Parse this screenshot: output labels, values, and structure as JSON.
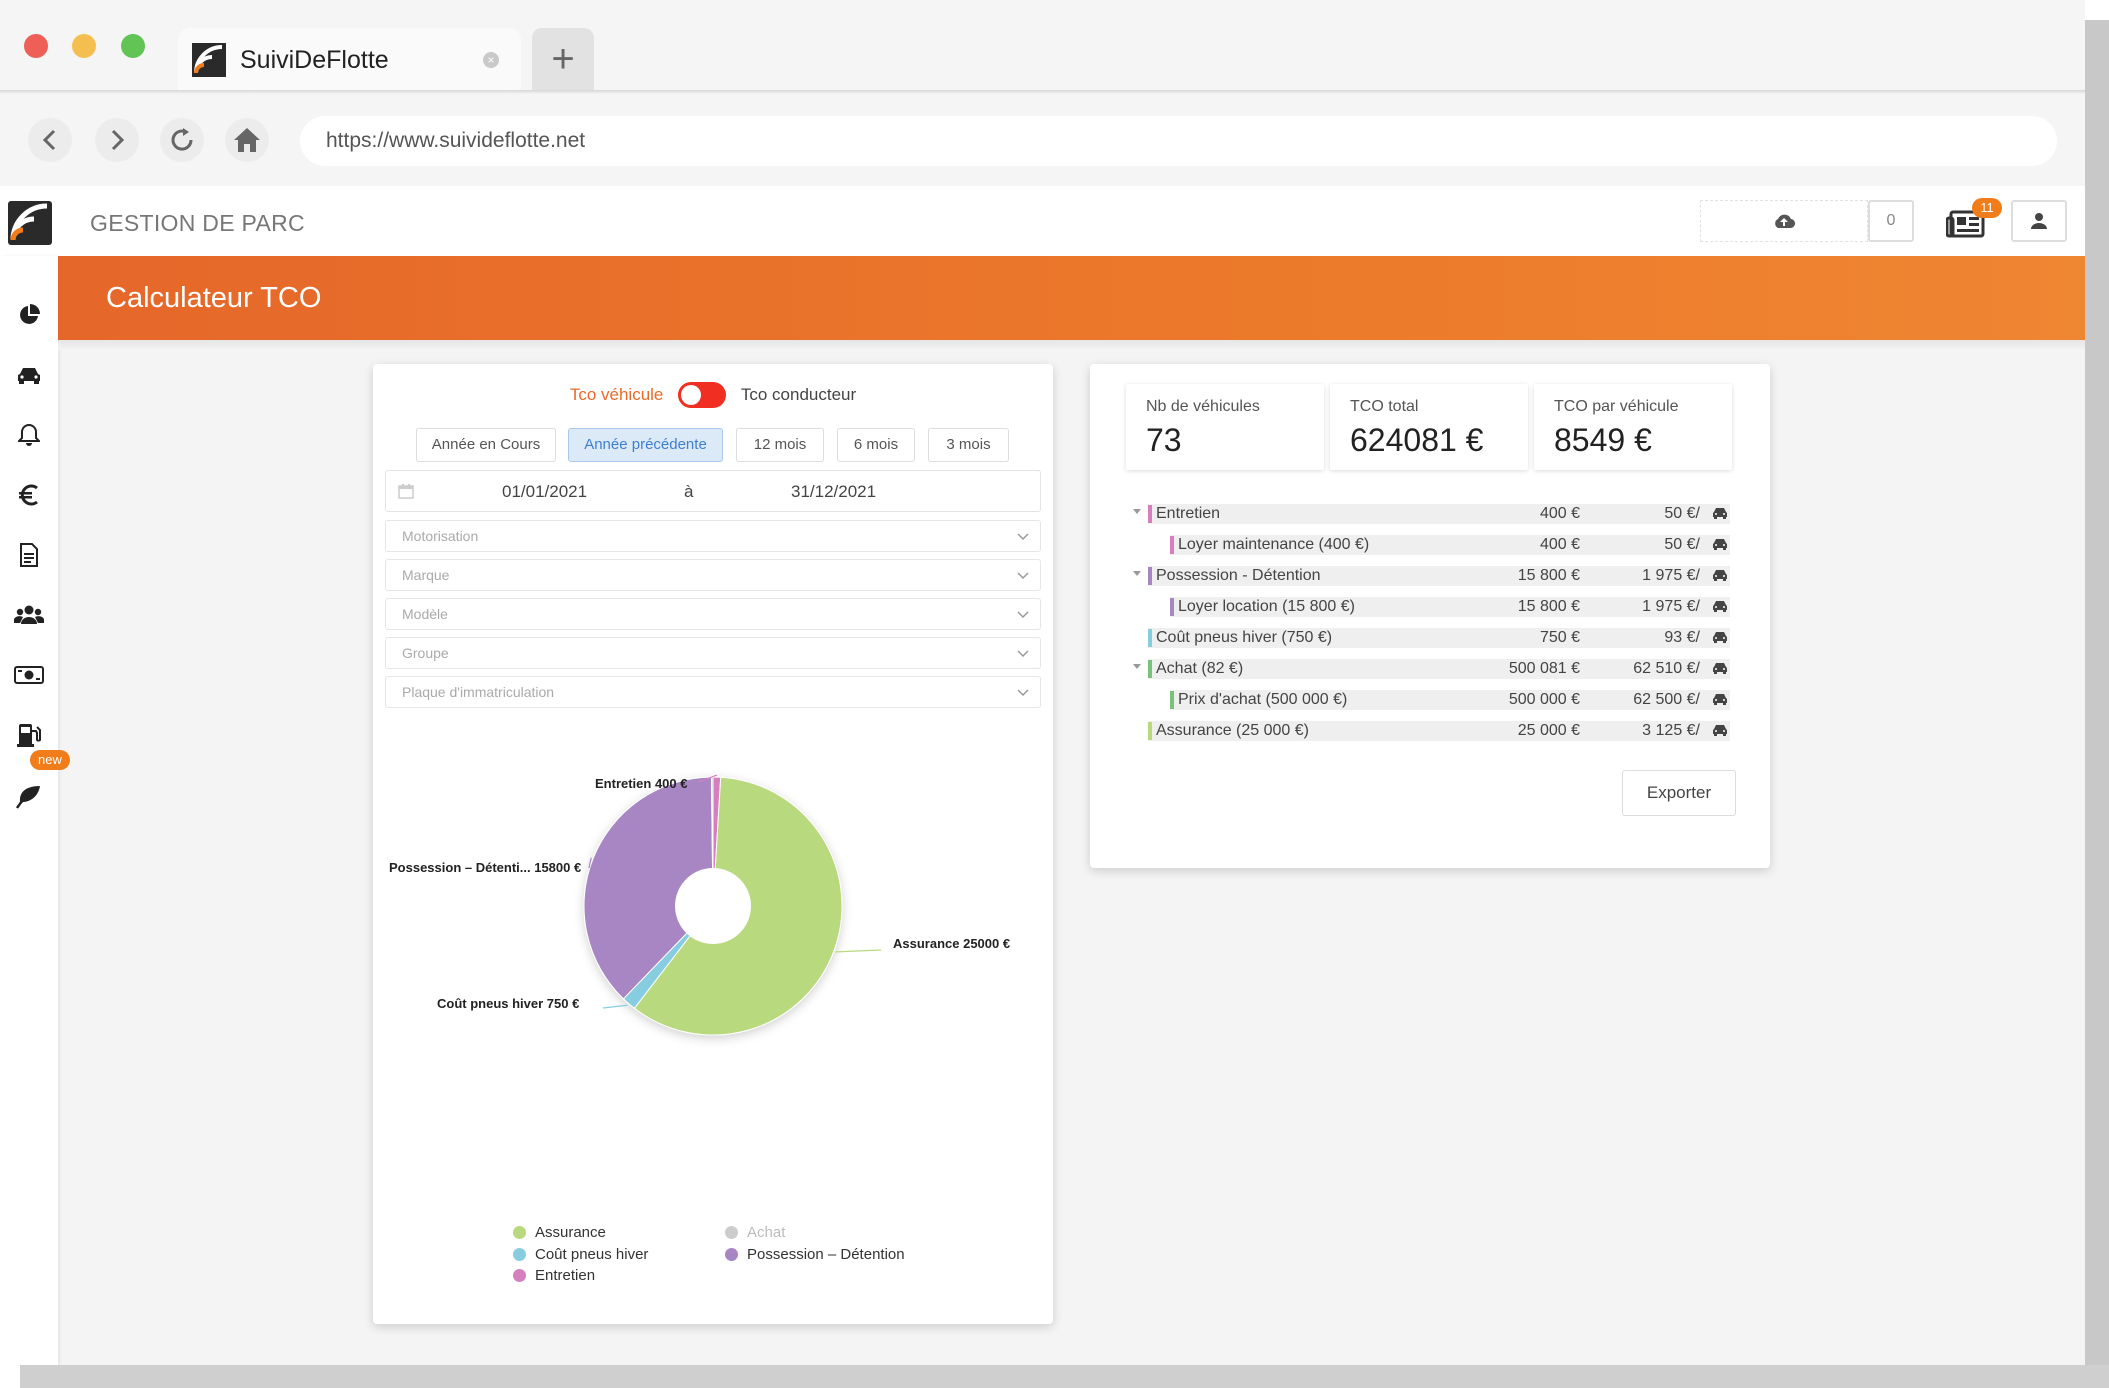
{
  "browser": {
    "tab_title": "SuiviDeFlotte",
    "tab_close": "×",
    "new_tab": "+",
    "url": "https://www.suivideflotte.net"
  },
  "header": {
    "app_title": "GESTION DE PARC",
    "upload_count": "0",
    "news_badge": "11"
  },
  "sidebar": {
    "icons": [
      "pie-chart-icon",
      "car-icon",
      "bell-icon",
      "euro-icon",
      "document-icon",
      "users-icon",
      "money-icon",
      "fuel-pump-icon",
      "leaf-icon"
    ],
    "new_badge": "new"
  },
  "page": {
    "title": "Calculateur TCO"
  },
  "filters": {
    "toggle_left": "Tco véhicule",
    "toggle_right": "Tco conducteur",
    "periods": [
      "Année en Cours",
      "Année précédente",
      "12 mois",
      "6 mois",
      "3 mois"
    ],
    "selected_period": "Année précédente",
    "date_from": "01/01/2021",
    "date_sep": "à",
    "date_to": "31/12/2021",
    "selects": [
      "Motorisation",
      "Marque",
      "Modèle",
      "Groupe",
      "Plaque d'immatriculation"
    ]
  },
  "chart_data": {
    "type": "pie",
    "donut": true,
    "slices": [
      {
        "name": "Entretien",
        "value": 400,
        "color": "#d67fbf",
        "label": "Entretien 400 €"
      },
      {
        "name": "Assurance",
        "value": 25000,
        "color": "#b9d97f",
        "label": "Assurance 25000 €"
      },
      {
        "name": "Coût pneus hiver",
        "value": 750,
        "color": "#86cde0",
        "label": "Coût pneus hiver 750 €"
      },
      {
        "name": "Possession – Détention",
        "value": 15800,
        "color": "#a886c4",
        "label": "Possession – Détenti... 15800 €"
      },
      {
        "name": "Achat",
        "value": 81,
        "color": "#cccccc",
        "label": ""
      }
    ],
    "legend": [
      {
        "name": "Assurance",
        "color": "#b9d97f",
        "muted": false
      },
      {
        "name": "Achat",
        "color": "#cccccc",
        "muted": true
      },
      {
        "name": "Coût pneus hiver",
        "color": "#86cde0",
        "muted": false
      },
      {
        "name": "Possession – Détention",
        "color": "#a886c4",
        "muted": false
      },
      {
        "name": "Entretien",
        "color": "#d67fbf",
        "muted": false
      }
    ]
  },
  "kpis": [
    {
      "label": "Nb de véhicules",
      "value": "73"
    },
    {
      "label": "TCO total",
      "value": "624081 €"
    },
    {
      "label": "TCO par véhicule",
      "value": "8549 €"
    }
  ],
  "breakdown": [
    {
      "label": "Entretien",
      "total": "400 €",
      "per_vehicle": "50 €/",
      "level": 0,
      "expandable": true,
      "color": "#d67fbf"
    },
    {
      "label": "Loyer maintenance (400 €)",
      "total": "400 €",
      "per_vehicle": "50 €/",
      "level": 1,
      "expandable": false,
      "color": "#d67fbf"
    },
    {
      "label": "Possession - Détention",
      "total": "15 800 €",
      "per_vehicle": "1 975 €/",
      "level": 0,
      "expandable": true,
      "color": "#a886c4"
    },
    {
      "label": "Loyer location (15 800 €)",
      "total": "15 800 €",
      "per_vehicle": "1 975 €/",
      "level": 1,
      "expandable": false,
      "color": "#a886c4"
    },
    {
      "label": "Coût pneus hiver (750 €)",
      "total": "750 €",
      "per_vehicle": "93 €/",
      "level": 0,
      "expandable": false,
      "color": "#86cde0"
    },
    {
      "label": "Achat (82 €)",
      "total": "500 081 €",
      "per_vehicle": "62 510 €/",
      "level": 0,
      "expandable": true,
      "color": "#7ac27a"
    },
    {
      "label": "Prix d'achat (500 000 €)",
      "total": "500 000 €",
      "per_vehicle": "62 500 €/",
      "level": 1,
      "expandable": false,
      "color": "#7ac27a"
    },
    {
      "label": "Assurance (25 000 €)",
      "total": "25 000 €",
      "per_vehicle": "3 125 €/",
      "level": 0,
      "expandable": false,
      "color": "#b9d97f"
    }
  ],
  "export_label": "Exporter"
}
